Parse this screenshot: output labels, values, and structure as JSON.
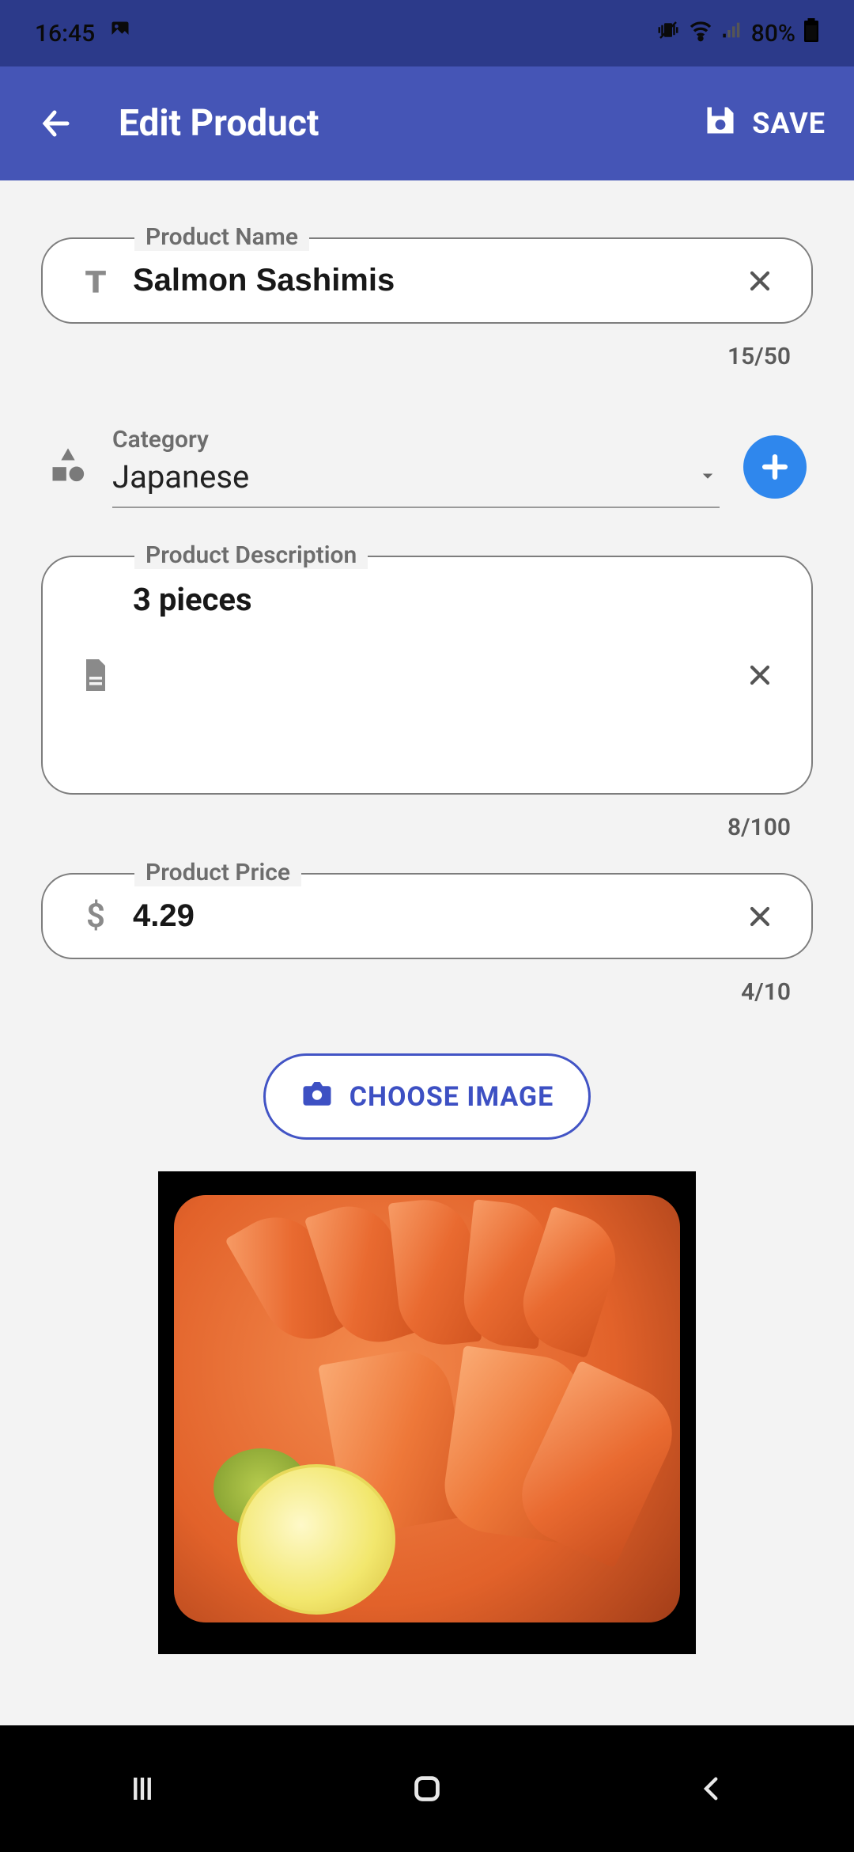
{
  "status": {
    "time": "16:45",
    "battery": "80%"
  },
  "appbar": {
    "title": "Edit Product",
    "save": "SAVE"
  },
  "fields": {
    "name": {
      "label": "Product Name",
      "value": "Salmon Sashimis",
      "counter": "15/50"
    },
    "category": {
      "label": "Category",
      "value": "Japanese"
    },
    "description": {
      "label": "Product Description",
      "value": "3 pieces",
      "counter": "8/100"
    },
    "price": {
      "label": "Product Price",
      "value": "4.29",
      "counter": "4/10"
    }
  },
  "buttons": {
    "choose_image": "CHOOSE IMAGE"
  }
}
